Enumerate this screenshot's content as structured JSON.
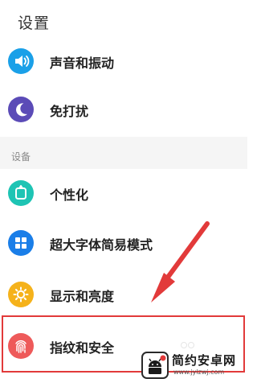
{
  "header": {
    "title": "设置"
  },
  "rows_top": [
    {
      "label": "声音和振动",
      "icon": "speaker-icon",
      "color": "#1aa0e8"
    },
    {
      "label": "免打扰",
      "icon": "moon-icon",
      "color": "#5b4bb7"
    }
  ],
  "section": {
    "title": "设备"
  },
  "rows_device": [
    {
      "label": "个性化",
      "icon": "personalize-icon",
      "color": "#1ec4b4"
    },
    {
      "label": "超大字体简易模式",
      "icon": "grid-icon",
      "color": "#1a7ee8"
    },
    {
      "label": "显示和亮度",
      "icon": "sun-icon",
      "color": "#f5b21b"
    },
    {
      "label": "指纹和安全",
      "icon": "fingerprint-icon",
      "color": "#ee5a5a"
    }
  ],
  "annotation": {
    "highlight_color": "#e23a3a"
  },
  "watermark": {
    "name": "简约安卓网",
    "url": "www.jylzwj.com"
  }
}
